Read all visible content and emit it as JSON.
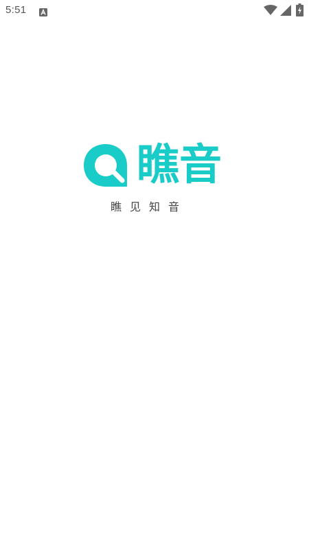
{
  "status_bar": {
    "time": "5:51",
    "notification_icon": "a-notification-icon",
    "wifi_icon": "wifi-icon",
    "signal_icon": "cell-signal-icon",
    "battery_icon": "battery-charging-icon"
  },
  "splash": {
    "logo_icon": "chat-bubble-q-logo-icon",
    "app_name": "瞧音",
    "slogan": "瞧见知音",
    "brand_color": "#19ccc8",
    "background_color": "#ffffff"
  }
}
